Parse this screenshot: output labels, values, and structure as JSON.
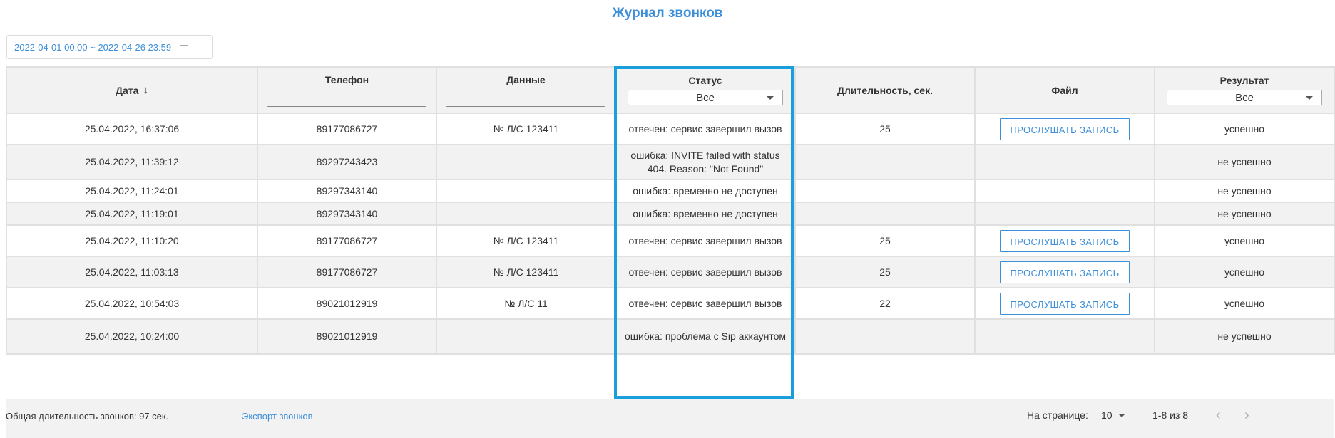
{
  "page": {
    "title": "Журнал звонков"
  },
  "date_filter": {
    "value": "2022-04-01 00:00 ~ 2022-04-26 23:59",
    "icon": "calendar-icon"
  },
  "table": {
    "headers": {
      "date": "Дата",
      "phone": "Телефон",
      "data": "Данные",
      "status": "Статус",
      "duration": "Длительность, сек.",
      "file": "Файл",
      "result": "Результат"
    },
    "sort_icon": "↓",
    "status_filter": "Все",
    "result_filter": "Все",
    "play_label": "ПРОСЛУШАТЬ ЗАПИСЬ",
    "rows": [
      {
        "date": "25.04.2022, 16:37:06",
        "phone": "89177086727",
        "data": "№ Л/С 123411",
        "status": "отвечен: сервис завершил вызов",
        "duration": "25",
        "has_file": true,
        "result": "успешно"
      },
      {
        "date": "25.04.2022, 11:39:12",
        "phone": "89297243423",
        "data": "",
        "status": "ошибка: INVITE failed with status 404. Reason: \"Not Found\"",
        "duration": "",
        "has_file": false,
        "result": "не успешно"
      },
      {
        "date": "25.04.2022, 11:24:01",
        "phone": "89297343140",
        "data": "",
        "status": "ошибка: временно не доступен",
        "duration": "",
        "has_file": false,
        "result": "не успешно"
      },
      {
        "date": "25.04.2022, 11:19:01",
        "phone": "89297343140",
        "data": "",
        "status": "ошибка: временно не доступен",
        "duration": "",
        "has_file": false,
        "result": "не успешно"
      },
      {
        "date": "25.04.2022, 11:10:20",
        "phone": "89177086727",
        "data": "№ Л/С 123411",
        "status": "отвечен: сервис завершил вызов",
        "duration": "25",
        "has_file": true,
        "result": "успешно"
      },
      {
        "date": "25.04.2022, 11:03:13",
        "phone": "89177086727",
        "data": "№ Л/С 123411",
        "status": "отвечен: сервис завершил вызов",
        "duration": "25",
        "has_file": true,
        "result": "успешно"
      },
      {
        "date": "25.04.2022, 10:54:03",
        "phone": "89021012919",
        "data": "№ Л/С 11",
        "status": "отвечен: сервис завершил вызов",
        "duration": "22",
        "has_file": true,
        "result": "успешно"
      },
      {
        "date": "25.04.2022, 10:24:00",
        "phone": "89021012919",
        "data": "",
        "status": "ошибка: проблема с Sip аккаунтом",
        "duration": "",
        "has_file": false,
        "result": "не успешно"
      }
    ]
  },
  "footer": {
    "total": "Общая длительность звонков: 97 сек.",
    "export": "Экспорт звонков",
    "per_page_label": "На странице:",
    "per_page_value": "10",
    "range": "1-8 из 8",
    "prev_icon": "‹",
    "next_icon": "›"
  },
  "colors": {
    "accent": "#3d8fd9",
    "highlight": "#1a9fdc",
    "row_alt": "#f2f2f2",
    "border": "#e0e0e0"
  }
}
